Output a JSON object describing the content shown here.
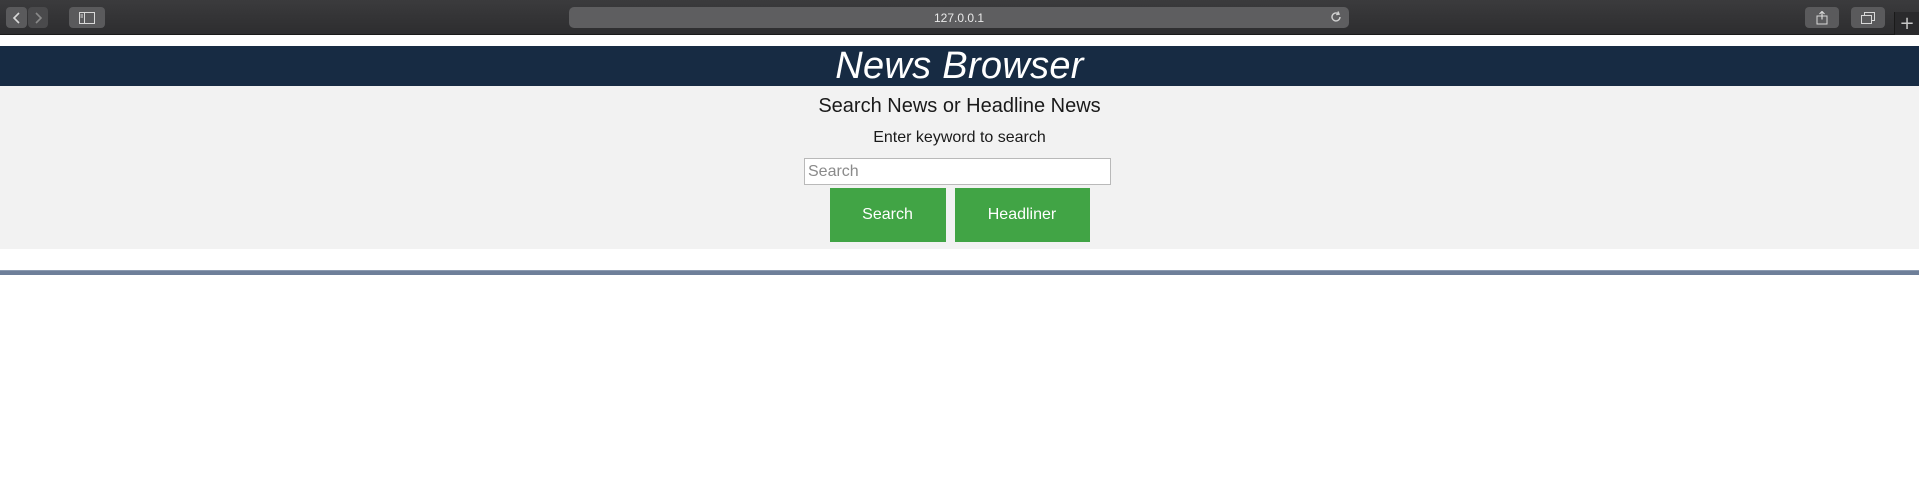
{
  "browser": {
    "url": "127.0.0.1",
    "icons": {
      "back": "chevron-left-icon",
      "forward": "chevron-right-icon",
      "sidebar": "sidebar-icon",
      "reload": "reload-icon",
      "share": "share-icon",
      "tabs": "tabs-overview-icon",
      "new_tab": "plus-icon"
    },
    "new_tab_glyph": "+"
  },
  "page": {
    "title": "News Browser",
    "subtitle": "Search News or Headline News",
    "instruction": "Enter keyword to search",
    "search": {
      "placeholder": "Search",
      "value": ""
    },
    "buttons": {
      "search_label": "Search",
      "headliner_label": "Headliner"
    },
    "colors": {
      "banner": "#172b43",
      "panel": "#f2f2f2",
      "button": "#41a445",
      "divider": "#6e7f99"
    }
  }
}
